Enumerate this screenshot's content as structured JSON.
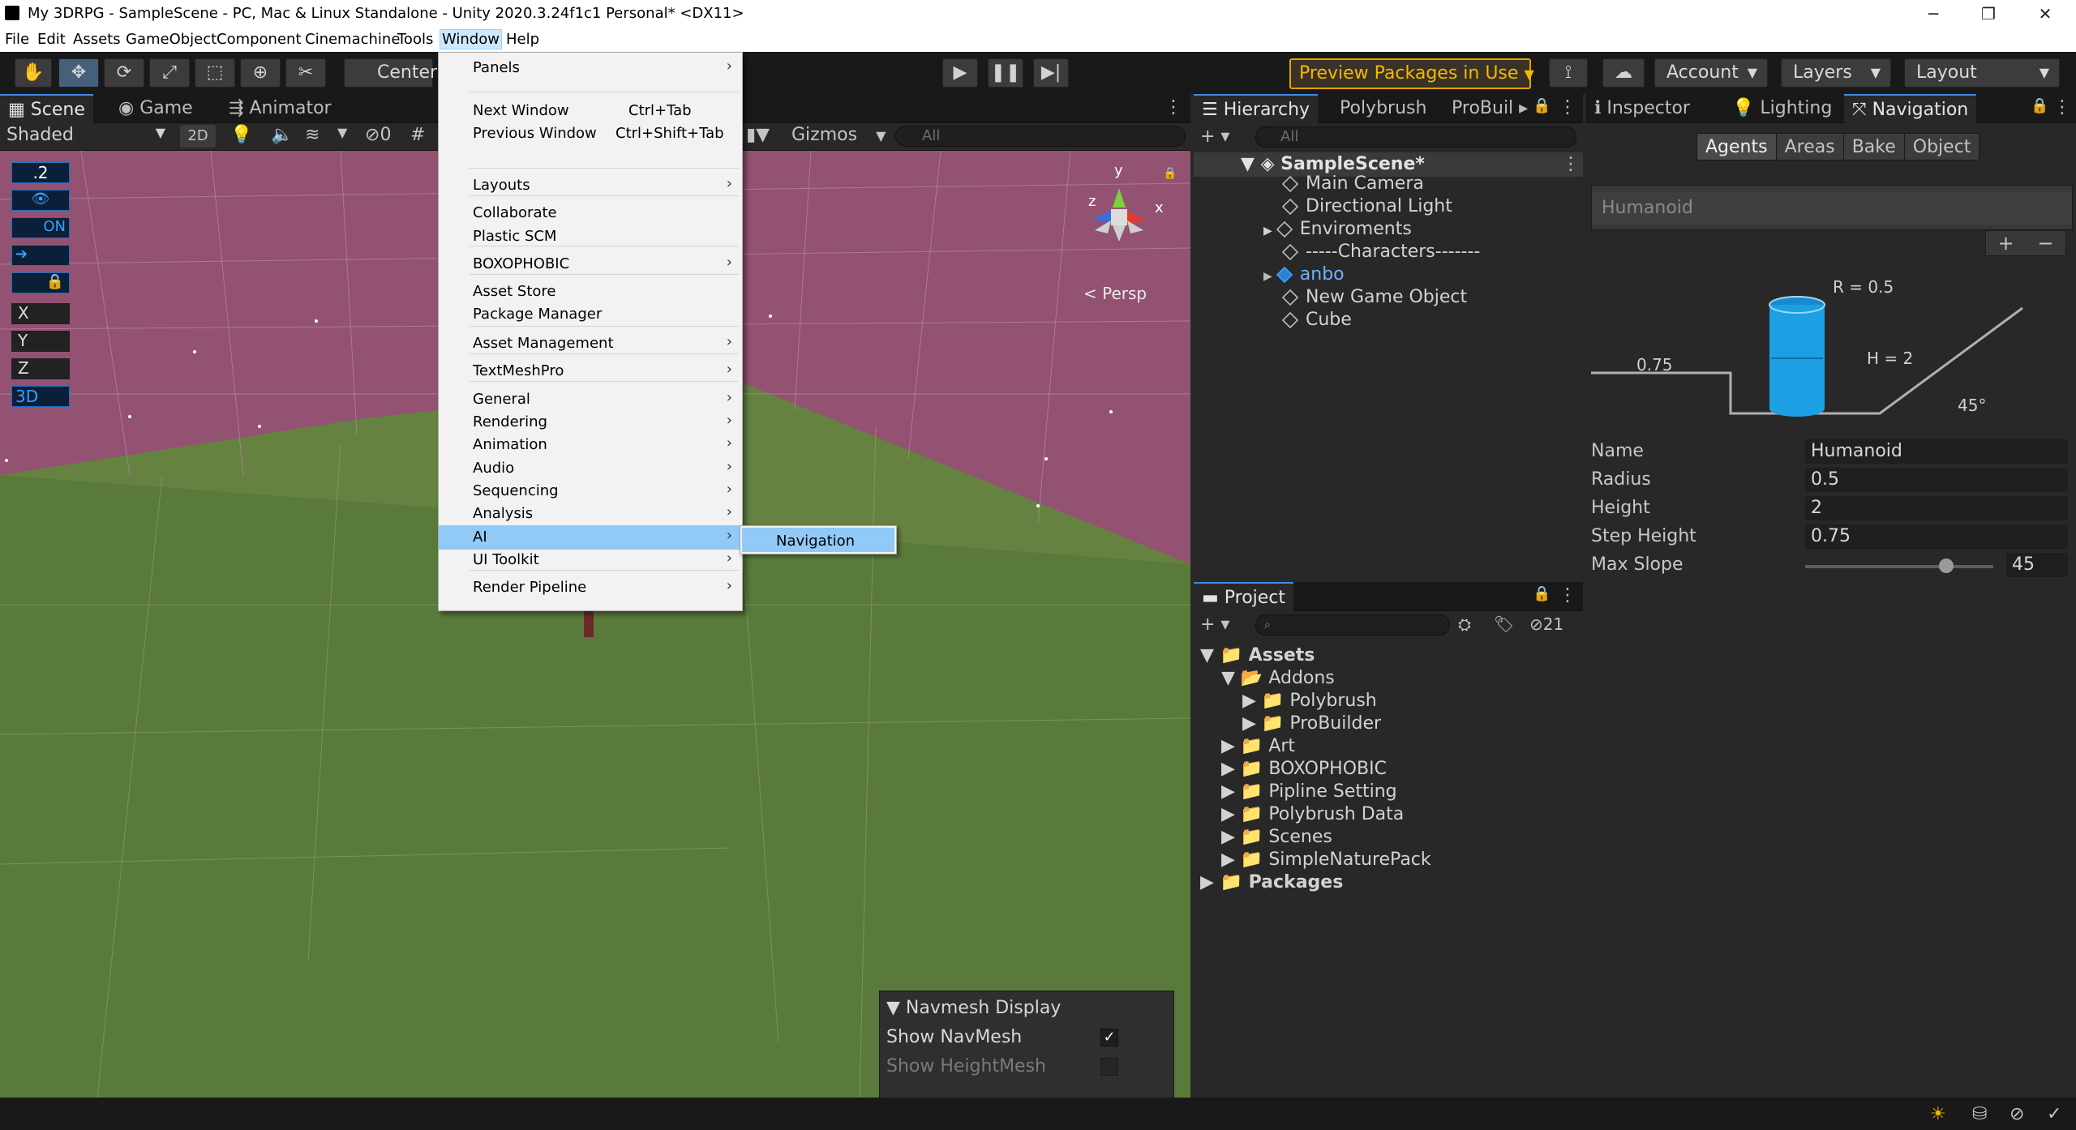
{
  "titlebar": {
    "title": "My 3DRPG - SampleScene - PC, Mac & Linux Standalone - Unity 2020.3.24f1c1 Personal* <DX11>",
    "minimize": "─",
    "maximize": "❐",
    "close": "✕"
  },
  "menubar": [
    "File",
    "Edit",
    "Assets",
    "GameObject",
    "Component",
    "Cinemachine",
    "Tools",
    "Window",
    "Help"
  ],
  "toolbar": {
    "pivot": "Center",
    "preview_packages": "Preview Packages in Use",
    "account": "Account",
    "layers": "Layers",
    "layout": "Layout"
  },
  "scene_tabs": [
    "Scene",
    "Game",
    "Animator"
  ],
  "scene_bar": {
    "shading": "Shaded",
    "mode2d": "2D",
    "hidden_count": "0",
    "gizmos": "Gizmos",
    "search_placeholder": "All"
  },
  "scene_overlay": {
    "grid_value": ".2",
    "on_label": "ON",
    "x": "X",
    "y": "Y",
    "z": "Z",
    "three_d": "3D",
    "persp": "< Persp",
    "gizmo_y": "y",
    "gizmo_x": "x",
    "gizmo_z": "z"
  },
  "navmesh_display": {
    "title": "Navmesh Display",
    "show_navmesh": "Show NavMesh",
    "show_heightmesh": "Show HeightMesh"
  },
  "window_menu": [
    {
      "label": "Panels",
      "arrow": true
    },
    {
      "label": "Next Window",
      "shortcut": "Ctrl+Tab"
    },
    {
      "label": "Previous Window",
      "shortcut": "Ctrl+Shift+Tab"
    },
    {
      "label": "Layouts",
      "arrow": true
    },
    {
      "label": "Collaborate"
    },
    {
      "label": "Plastic SCM"
    },
    {
      "label": "BOXOPHOBIC",
      "arrow": true
    },
    {
      "label": "Asset Store"
    },
    {
      "label": "Package Manager"
    },
    {
      "label": "Asset Management",
      "arrow": true
    },
    {
      "label": "TextMeshPro",
      "arrow": true
    },
    {
      "label": "General",
      "arrow": true
    },
    {
      "label": "Rendering",
      "arrow": true
    },
    {
      "label": "Animation",
      "arrow": true
    },
    {
      "label": "Audio",
      "arrow": true
    },
    {
      "label": "Sequencing",
      "arrow": true
    },
    {
      "label": "Analysis",
      "arrow": true
    },
    {
      "label": "AI",
      "arrow": true,
      "highlighted": true
    },
    {
      "label": "UI Toolkit",
      "arrow": true
    },
    {
      "label": "Render Pipeline",
      "arrow": true
    }
  ],
  "ai_submenu": {
    "label": "Navigation"
  },
  "hierarchy": {
    "tabs": [
      "Hierarchy",
      "Polybrush",
      "ProBuil"
    ],
    "search_placeholder": "All",
    "scene": "SampleScene*",
    "items": [
      "Main Camera",
      "Directional Light",
      "Enviroments",
      "-----Characters-------",
      "anbo",
      "New Game Object",
      "Cube"
    ]
  },
  "project": {
    "tab": "Project",
    "hidden_count": "21",
    "items": [
      "Assets",
      "Addons",
      "Polybrush",
      "ProBuilder",
      "Art",
      "BOXOPHOBIC",
      "Pipline Setting",
      "Polybrush Data",
      "Scenes",
      "SimpleNaturePack",
      "Packages"
    ]
  },
  "inspector": {
    "tabs": [
      "Inspector",
      "Lighting",
      "Navigation"
    ],
    "nav_tabs": [
      "Agents",
      "Areas",
      "Bake",
      "Object"
    ],
    "agent_list_item": "Humanoid",
    "add": "+",
    "remove": "−",
    "diagram": {
      "r": "R = 0.5",
      "h": "H = 2",
      "step": "0.75",
      "slope": "45°"
    },
    "fields": [
      {
        "label": "Name",
        "value": "Humanoid"
      },
      {
        "label": "Radius",
        "value": "0.5"
      },
      {
        "label": "Height",
        "value": "2"
      },
      {
        "label": "Step Height",
        "value": "0.75"
      },
      {
        "label": "Max Slope",
        "value": "45"
      }
    ],
    "max_slope_fraction": 0.75
  }
}
